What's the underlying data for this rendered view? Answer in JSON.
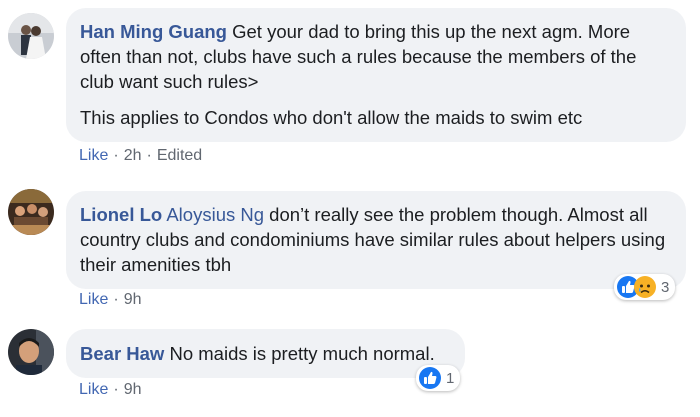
{
  "comments": [
    {
      "author": "Han Ming Guang",
      "paragraphs": [
        "Get your dad to bring this up the next agm. More often than not, clubs have such a rules because the members of the club want such rules>",
        "This applies to Condos who don't allow the maids to swim etc"
      ],
      "like_label": "Like",
      "time": "2h",
      "edited": "Edited"
    },
    {
      "author": "Lionel Lo",
      "mention": "Aloysius Ng",
      "text": "don’t really see the problem though. Almost all country clubs and condominiums have similar rules about helpers using their amenities tbh",
      "like_label": "Like",
      "time": "9h",
      "reaction_count": "3",
      "reaction_icons": [
        "like-icon",
        "sad-icon"
      ]
    },
    {
      "author": "Bear Haw",
      "text": "No maids is pretty much normal.",
      "like_label": "Like",
      "time": "9h",
      "reaction_count": "1",
      "reaction_icons": [
        "like-icon"
      ]
    }
  ],
  "separator": "·",
  "colors": {
    "name": "#385898",
    "bubble": "#f0f2f5",
    "like_blue": "#1877f2",
    "meta": "#616770",
    "sad_yellow": "#f7b125"
  }
}
